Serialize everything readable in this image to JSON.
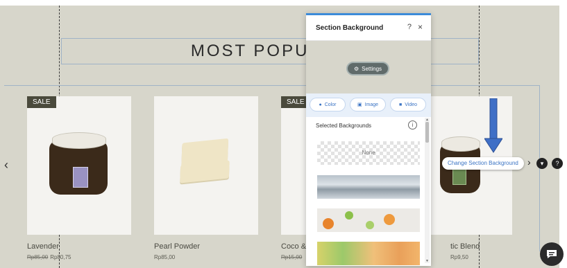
{
  "page": {
    "section_title": "MOST POPULAR"
  },
  "carousel": {
    "prev_arrow": "‹",
    "next_arrow": "›",
    "products": [
      {
        "name": "Lavender",
        "sale": "SALE",
        "old_price": "Rp85,00",
        "price": "Rp80,75"
      },
      {
        "name": "Pearl Powder",
        "sale": "",
        "old_price": "",
        "price": "Rp85,00"
      },
      {
        "name": "Coco &",
        "sale": "SALE",
        "old_price": "Rp15,00",
        "price": ""
      },
      {
        "name": "tic Blend",
        "sale": "",
        "old_price": "",
        "price": "Rp9,50"
      }
    ]
  },
  "panel": {
    "title": "Section Background",
    "help": "?",
    "close": "×",
    "settings_label": "Settings",
    "media_buttons": [
      {
        "label": "Color",
        "icon": "droplet-icon"
      },
      {
        "label": "Image",
        "icon": "image-icon"
      },
      {
        "label": "Video",
        "icon": "video-icon"
      }
    ],
    "selected_heading": "Selected Backgrounds",
    "info": "i",
    "none_label": "None"
  },
  "tooltip": {
    "text": "Change Section Background"
  },
  "colors": {
    "canvas_bg": "#d7d6cb",
    "panel_accent": "#3c8bd9",
    "link_blue": "#3b74c4",
    "arrow_blue": "#3f6fc6"
  }
}
